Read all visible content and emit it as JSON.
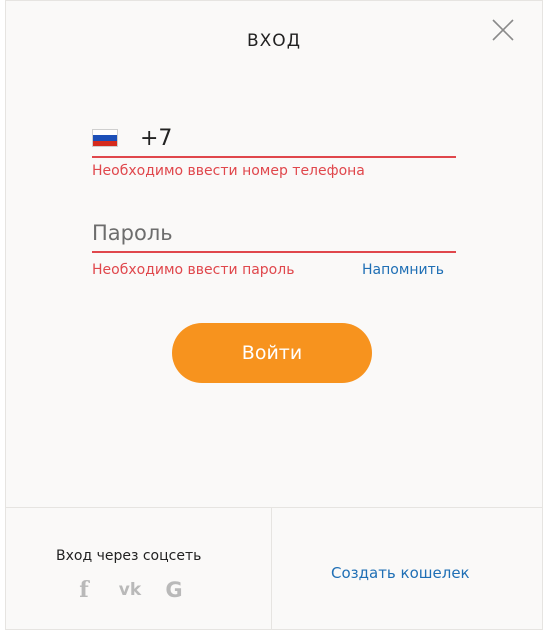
{
  "dialog": {
    "title": "ВХОД",
    "close_icon": "close-icon"
  },
  "phone": {
    "country_flag_icon": "russia-flag-icon",
    "value": "+7",
    "error": "Необходимо ввести номер телефона"
  },
  "password": {
    "placeholder": "Пароль",
    "error": "Необходимо ввести пароль",
    "remind_label": "Напомнить"
  },
  "login_button": {
    "label": "Войти",
    "color": "#f7931e"
  },
  "footer": {
    "social_title": "Вход через соцсеть",
    "social_icons": [
      "facebook-icon",
      "vk-icon",
      "google-icon"
    ],
    "facebook_glyph": "f",
    "vk_glyph": "vk",
    "google_glyph": "G",
    "create_wallet_label": "Создать кошелек"
  },
  "colors": {
    "error": "#e0474c",
    "link": "#1f6fb5",
    "accent": "#f7931e"
  }
}
